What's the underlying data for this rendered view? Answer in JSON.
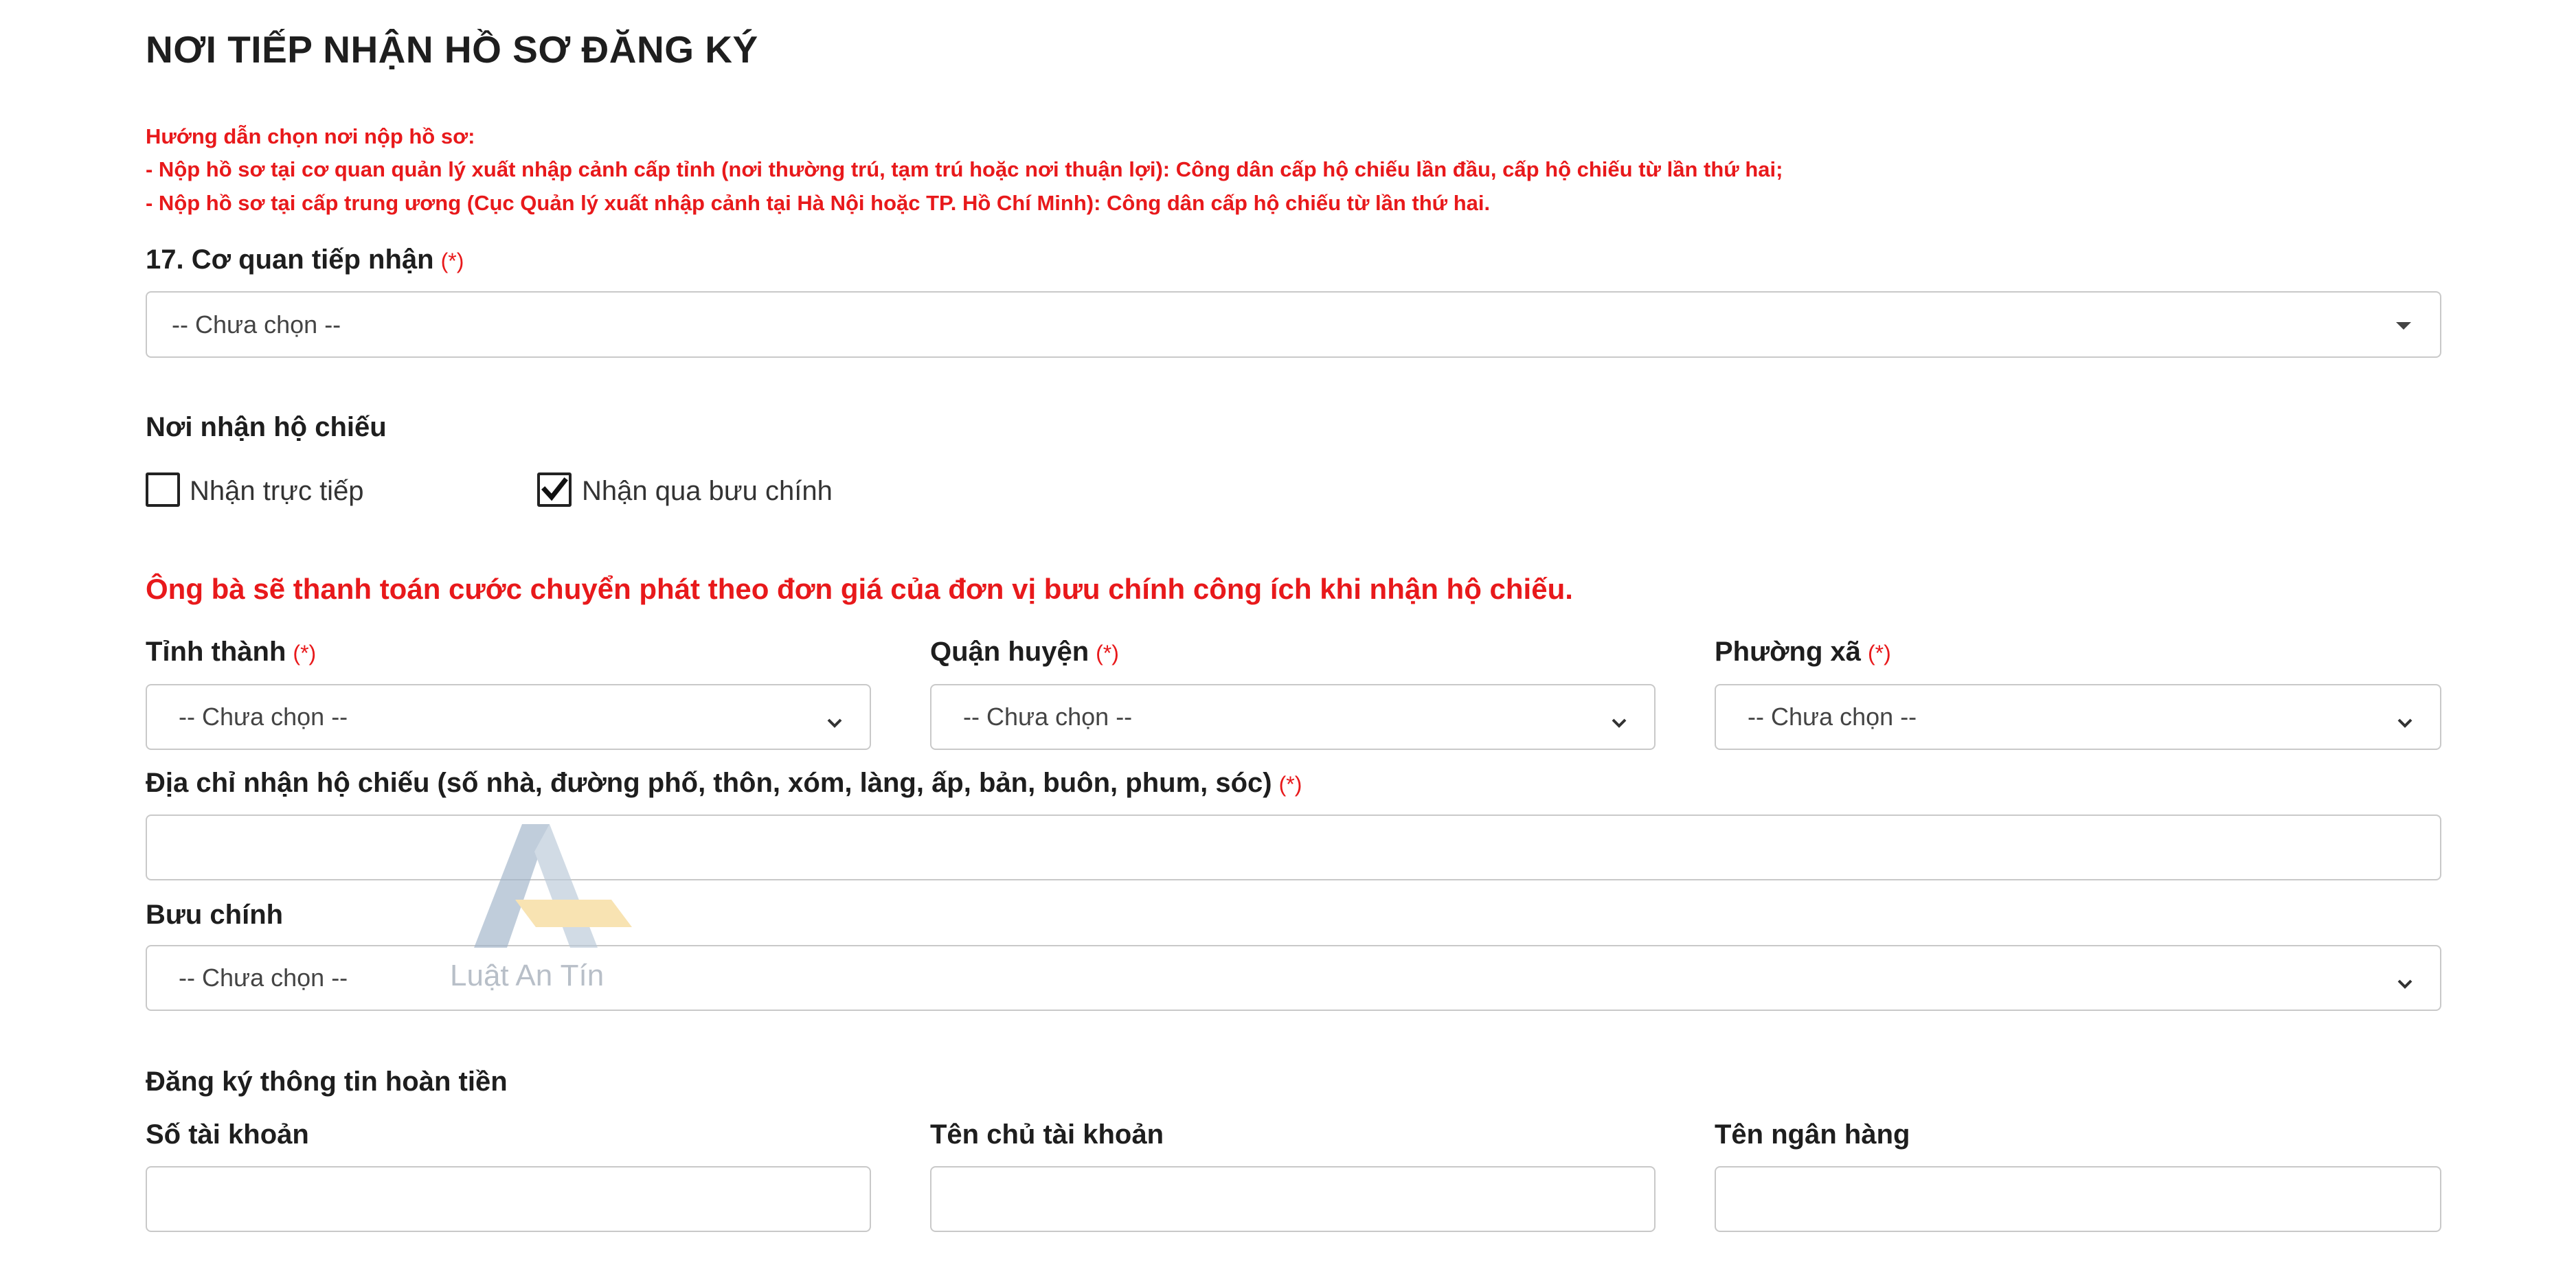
{
  "section_title": "NƠI TIẾP NHẬN HỒ SƠ ĐĂNG KÝ",
  "guide": {
    "line1": "Hướng dẫn chọn nơi nộp hồ sơ:",
    "line2": "- Nộp hồ sơ tại cơ quan quản lý xuất nhập cảnh cấp tỉnh (nơi thường trú, tạm trú hoặc nơi thuận lợi): Công dân cấp hộ chiếu lần đầu, cấp hộ chiếu từ lần thứ hai;",
    "line3": "- Nộp hồ sơ tại cấp trung ương (Cục Quản lý xuất nhập cảnh tại Hà Nội hoặc TP. Hồ Chí Minh): Công dân cấp hộ chiếu từ lần thứ hai."
  },
  "required_mark": "(*)",
  "receiving_agency": {
    "label": "17. Cơ quan tiếp nhận",
    "value": "-- Chưa chọn --"
  },
  "passport_receipt": {
    "label": "Nơi nhận hộ chiếu",
    "options": [
      {
        "label": "Nhận trực tiếp",
        "checked": false
      },
      {
        "label": "Nhận qua bưu chính",
        "checked": true
      }
    ]
  },
  "postal_notice": "Ông bà sẽ thanh toán cước chuyển phát theo đơn giá của đơn vị bưu chính công ích khi nhận hộ chiếu.",
  "address": {
    "province": {
      "label": "Tỉnh thành",
      "value": "-- Chưa chọn --"
    },
    "district": {
      "label": "Quận huyện",
      "value": "-- Chưa chọn --"
    },
    "ward": {
      "label": "Phường xã",
      "value": "-- Chưa chọn --"
    },
    "street_label": "Địa chỉ nhận hộ chiếu (số nhà, đường phố, thôn, xóm, làng, ấp, bản, buôn, phum, sóc)",
    "street_value": ""
  },
  "post_office": {
    "label": "Bưu chính",
    "value": "-- Chưa chọn --"
  },
  "refund": {
    "heading": "Đăng ký thông tin hoàn tiền",
    "account_number_label": "Số tài khoản",
    "account_holder_label": "Tên chủ tài khoản",
    "bank_name_label": "Tên ngân hàng",
    "account_number_value": "",
    "account_holder_value": "",
    "bank_name_value": ""
  },
  "watermark": {
    "text": "Luật An Tín",
    "colors": {
      "blue": "#9fb3c8",
      "gold": "#f5d58a"
    }
  }
}
